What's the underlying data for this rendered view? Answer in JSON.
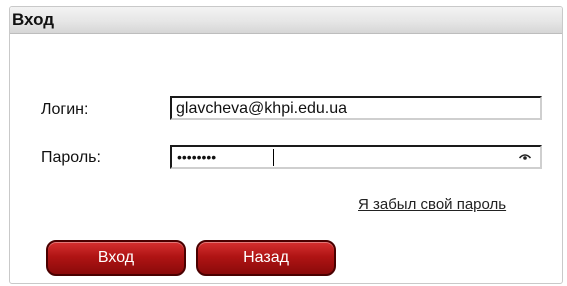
{
  "panel": {
    "title": "Вход"
  },
  "form": {
    "login_label": "Логин:",
    "login_value": "glavcheva@khpi.edu.ua",
    "password_label": "Пароль:",
    "password_value": "••••••••"
  },
  "links": {
    "forgot_password": "Я забыл свой пароль"
  },
  "buttons": {
    "login": "Вход",
    "back": "Назад"
  },
  "colors": {
    "button_red": "#b01414",
    "header_gray": "#e6e6e6"
  },
  "icons": {
    "password_toggle": "eye-icon"
  }
}
